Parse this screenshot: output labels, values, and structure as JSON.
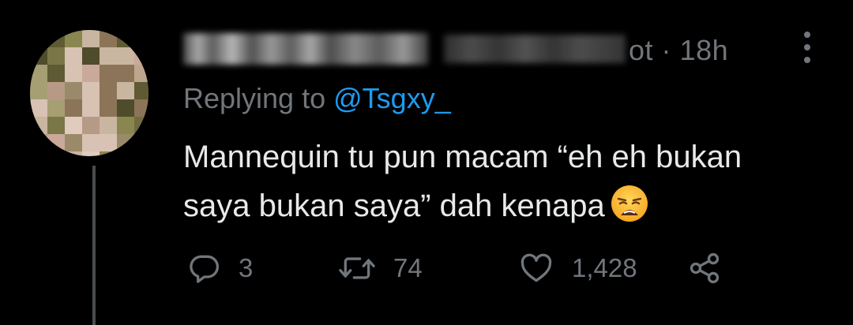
{
  "tweet": {
    "author_name": "",
    "handle_visible_tail": "ot",
    "separator": "·",
    "timestamp": "18h",
    "replying_prefix": "Replying to",
    "replying_mention": "@Tsgxy_",
    "text_line1": "Mannequin tu pun macam “eh eh bukan",
    "text_line2": "saya bukan saya” dah kenapa",
    "emoji": "weary-face"
  },
  "actions": {
    "reply_count": "3",
    "retweet_count": "74",
    "like_count": "1,428"
  },
  "colors": {
    "background": "#000000",
    "primary_text": "#e7e9ea",
    "secondary_text": "#71767b",
    "link": "#1d9bf0",
    "thread_line": "#4a4d50"
  },
  "icons": {
    "more": "more-dots-vertical-icon",
    "reply": "reply-bubble-icon",
    "retweet": "retweet-icon",
    "like": "heart-icon",
    "share": "share-icon"
  }
}
